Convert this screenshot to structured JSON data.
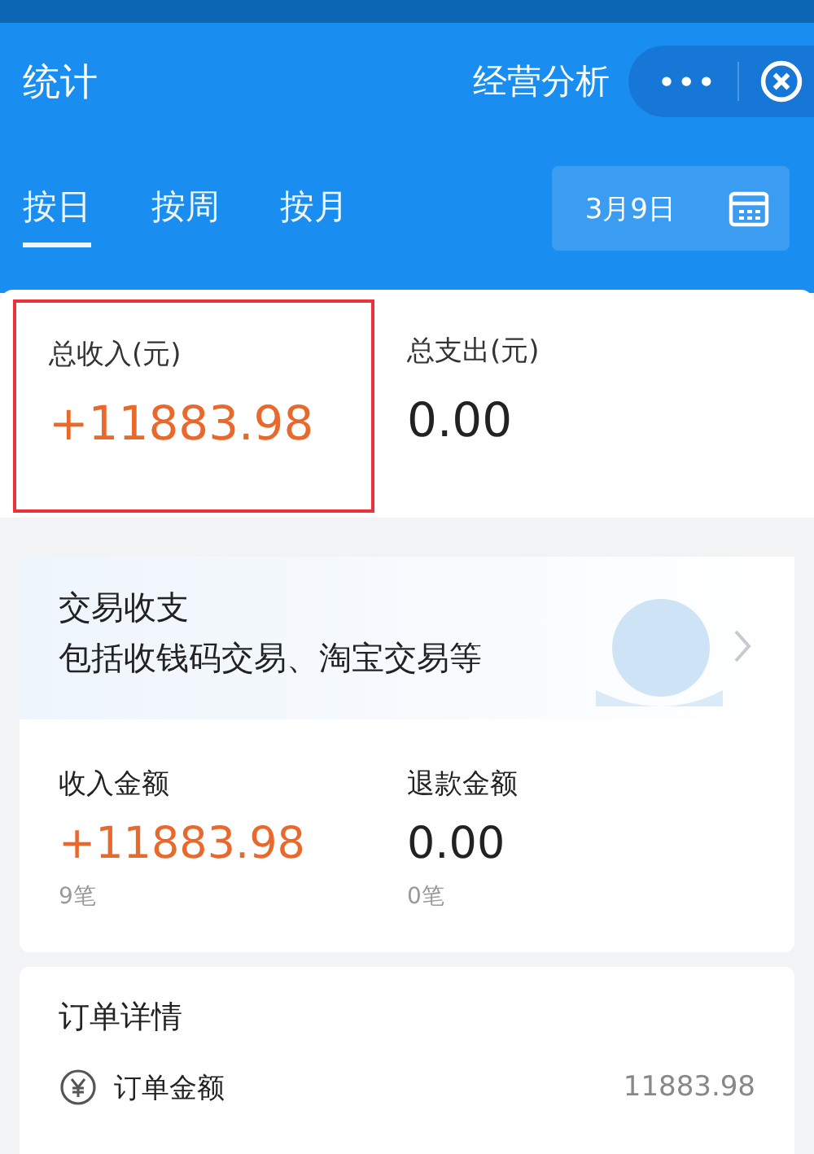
{
  "header": {
    "title": "统计",
    "link": "经营分析",
    "more": "•••"
  },
  "tabs": [
    {
      "label": "按日",
      "selected": true
    },
    {
      "label": "按周",
      "selected": false
    },
    {
      "label": "按月",
      "selected": false
    }
  ],
  "date": "3月9日",
  "totals": [
    {
      "label": "总收入(元)",
      "value": "+11883.98",
      "positive": true,
      "highlighted": true
    },
    {
      "label": "总支出(元)",
      "value": "0.00",
      "positive": false,
      "highlighted": false
    }
  ],
  "transactions": {
    "title": "交易收支",
    "subtitle": "包括收钱码交易、淘宝交易等",
    "stats": [
      {
        "label": "收入金额",
        "value": "+11883.98",
        "positive": true,
        "count": "9笔"
      },
      {
        "label": "退款金额",
        "value": "0.00",
        "positive": false,
        "count": "0笔"
      }
    ]
  },
  "orders": {
    "title": "订单详情",
    "rows": [
      {
        "label": "订单金额",
        "value": "11883.98"
      }
    ]
  }
}
